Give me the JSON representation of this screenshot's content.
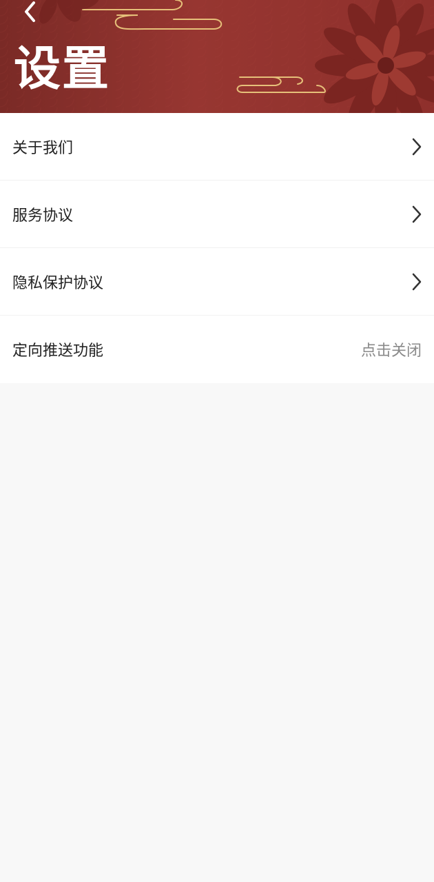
{
  "header": {
    "title": "设置",
    "back_icon": "chevron-left-icon",
    "bg_color": "#8f302c",
    "accent_color": "#e6c07a"
  },
  "settings": {
    "items": [
      {
        "label": "关于我们",
        "icon": "chevron-right-icon"
      },
      {
        "label": "服务协议",
        "icon": "chevron-right-icon"
      },
      {
        "label": "隐私保护协议",
        "icon": "chevron-right-icon"
      },
      {
        "label": "定向推送功能",
        "value": "点击关闭"
      }
    ]
  }
}
